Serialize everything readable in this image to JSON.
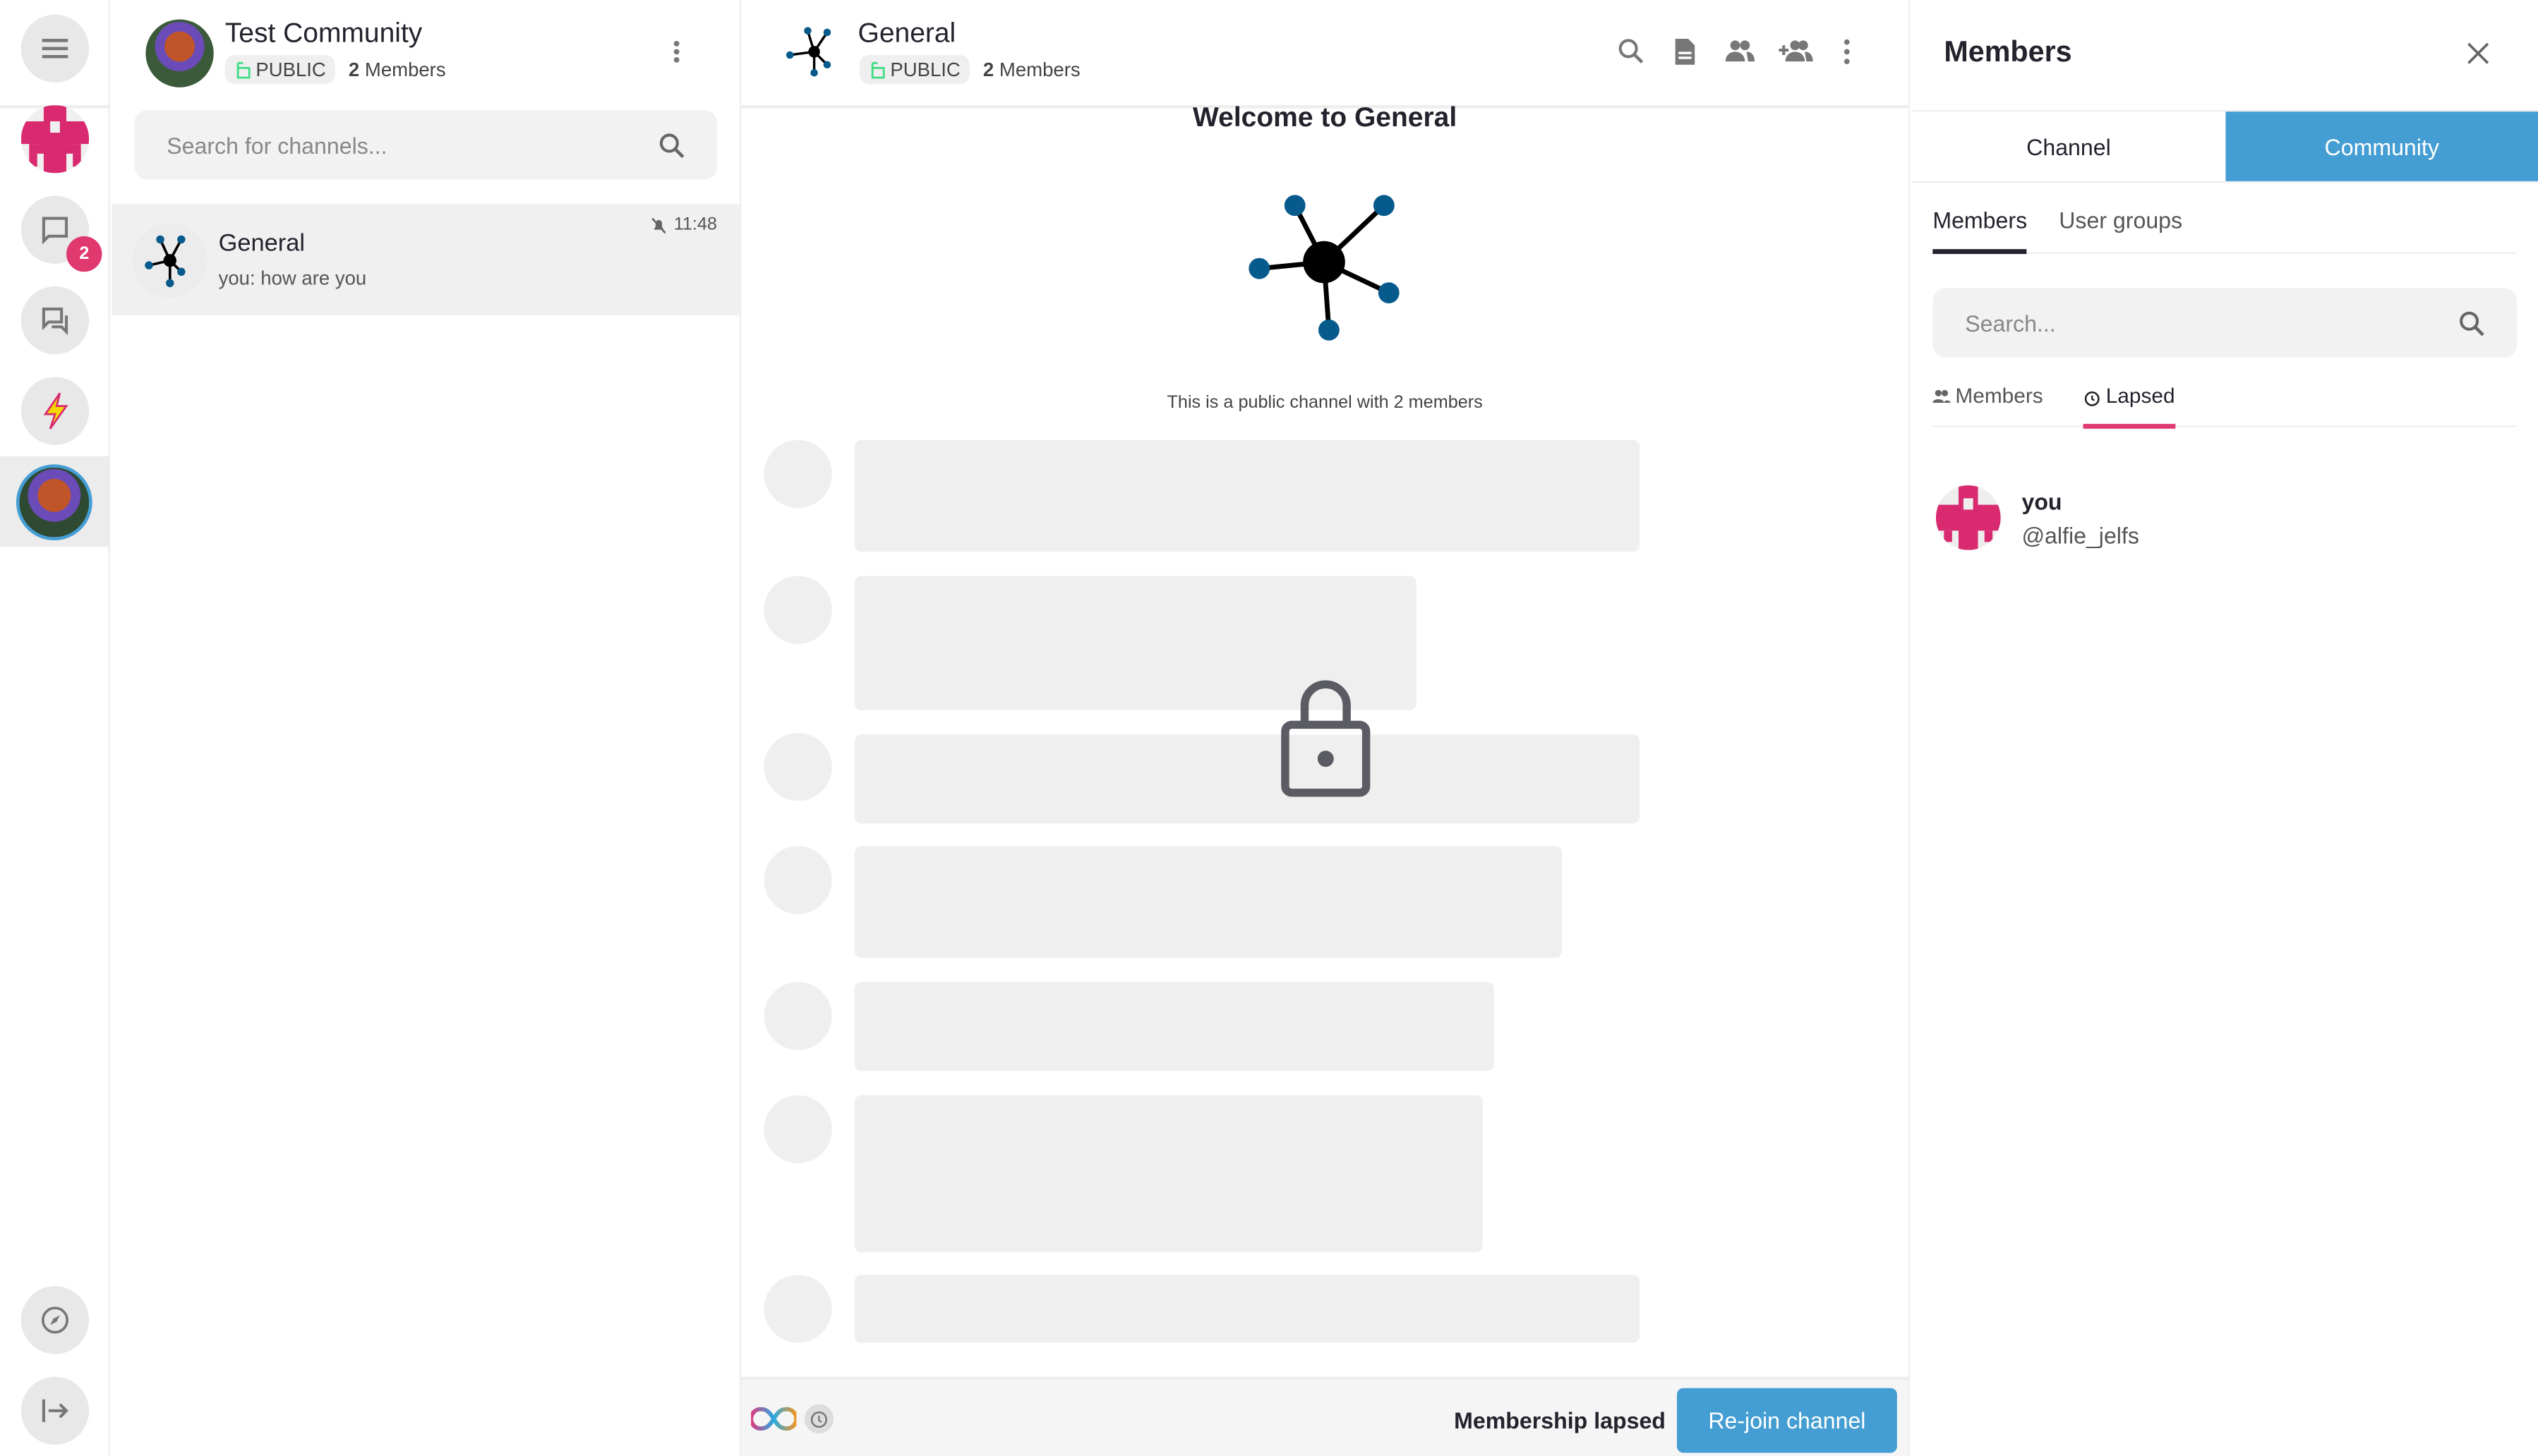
{
  "rail": {
    "badge": "2"
  },
  "community": {
    "name": "Test Community",
    "visibility": "PUBLIC",
    "member_count": "2",
    "members_label": "Members",
    "search_placeholder": "Search for channels..."
  },
  "channels": [
    {
      "name": "General",
      "preview": "you: how are you",
      "time": "11:48",
      "muted": true
    }
  ],
  "channel": {
    "name": "General",
    "visibility": "PUBLIC",
    "member_count": "2",
    "members_label": "Members",
    "welcome": "Welcome to General",
    "description": "This is a public channel with 2 members"
  },
  "footer": {
    "status": "Membership lapsed",
    "rejoin": "Re-join channel"
  },
  "panel": {
    "title": "Members",
    "tabs": [
      "Channel",
      "Community"
    ],
    "active_tab": "Community",
    "subtabs": [
      "Members",
      "User groups"
    ],
    "search_placeholder": "Search...",
    "filters": [
      "Members",
      "Lapsed"
    ],
    "members": [
      {
        "name": "you",
        "handle": "@alfie_jelfs"
      }
    ]
  },
  "colors": {
    "accent": "#459ed3",
    "pink": "#d92a6f",
    "node": "#065a8c"
  }
}
